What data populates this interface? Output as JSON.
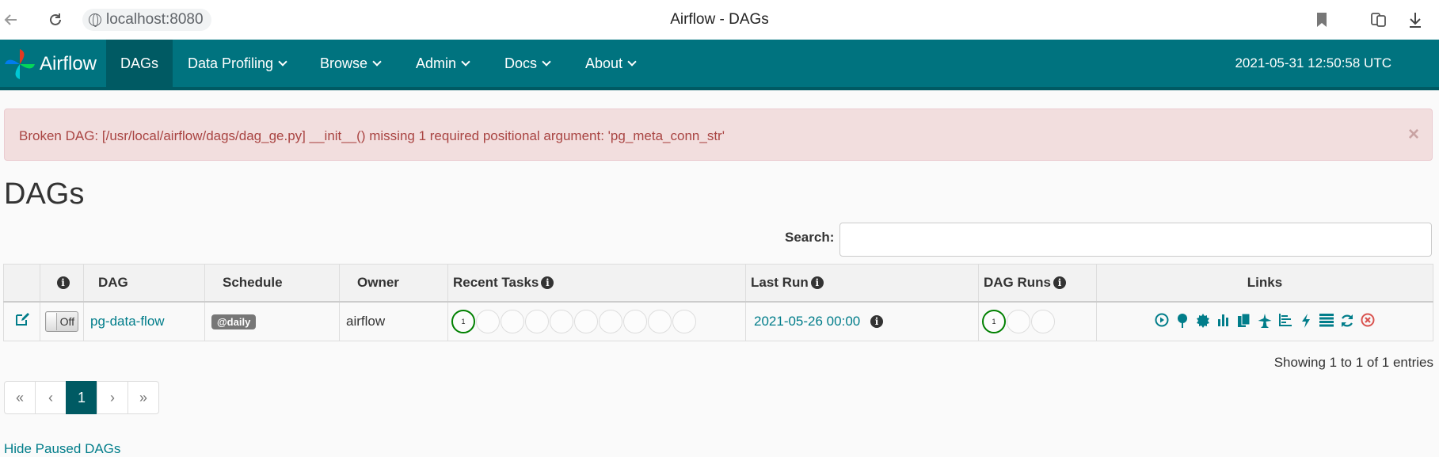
{
  "browser": {
    "url": "localhost:8080",
    "title": "Airflow - DAGs"
  },
  "navbar": {
    "brand": "Airflow",
    "items": [
      {
        "label": "DAGs"
      },
      {
        "label": "Data Profiling"
      },
      {
        "label": "Browse"
      },
      {
        "label": "Admin"
      },
      {
        "label": "Docs"
      },
      {
        "label": "About"
      }
    ],
    "datetime": "2021-05-31 12:50:58 UTC"
  },
  "alert": {
    "message": "Broken DAG: [/usr/local/airflow/dags/dag_ge.py] __init__() missing 1 required positional argument: 'pg_meta_conn_str'",
    "close": "×"
  },
  "page_title": "DAGs",
  "search": {
    "label": "Search:",
    "value": ""
  },
  "table": {
    "headers": {
      "dag": "DAG",
      "schedule": "Schedule",
      "owner": "Owner",
      "recent_tasks": "Recent Tasks",
      "last_run": "Last Run",
      "dag_runs": "DAG Runs",
      "links": "Links"
    },
    "rows": [
      {
        "toggle": "Off",
        "dag": "pg-data-flow",
        "schedule": "@daily",
        "owner": "airflow",
        "recent_tasks_success": "1",
        "last_run": "2021-05-26 00:00",
        "dag_runs_success": "1"
      }
    ]
  },
  "showing": "Showing 1 to 1 of 1 entries",
  "pagination": {
    "first": "«",
    "prev": "‹",
    "current": "1",
    "next": "›",
    "last": "»"
  },
  "hide_paused": "Hide Paused DAGs",
  "colors": {
    "navbar": "#00737f",
    "accent": "#017d8a",
    "success": "#008000",
    "alert_bg": "#f2dede",
    "alert_text": "#a94442"
  }
}
